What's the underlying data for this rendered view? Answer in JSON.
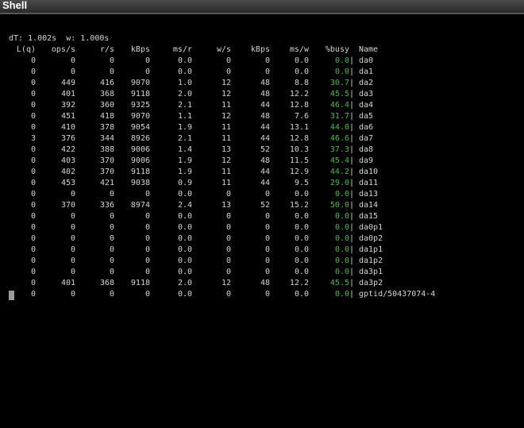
{
  "window": {
    "title": "Shell"
  },
  "terminal": {
    "status_line": "dT: 1.002s  w: 1.000s",
    "columns": [
      "L(q)",
      "ops/s",
      "r/s",
      "kBps",
      "ms/r",
      "w/s",
      "kBps",
      "ms/w",
      "%busy",
      "Name"
    ],
    "rows": [
      [
        "0",
        "0",
        "0",
        "0",
        "0.0",
        "0",
        "0",
        "0.0",
        "0.0",
        "da0"
      ],
      [
        "0",
        "0",
        "0",
        "0",
        "0.0",
        "0",
        "0",
        "0.0",
        "0.0",
        "da1"
      ],
      [
        "0",
        "449",
        "416",
        "9070",
        "1.0",
        "12",
        "48",
        "8.8",
        "30.7",
        "da2"
      ],
      [
        "0",
        "401",
        "368",
        "9118",
        "2.0",
        "12",
        "48",
        "12.2",
        "45.5",
        "da3"
      ],
      [
        "0",
        "392",
        "360",
        "9325",
        "2.1",
        "11",
        "44",
        "12.8",
        "46.4",
        "da4"
      ],
      [
        "0",
        "451",
        "418",
        "9070",
        "1.1",
        "12",
        "48",
        "7.6",
        "31.7",
        "da5"
      ],
      [
        "0",
        "410",
        "378",
        "9054",
        "1.9",
        "11",
        "44",
        "13.1",
        "44.0",
        "da6"
      ],
      [
        "3",
        "376",
        "344",
        "8926",
        "2.1",
        "11",
        "44",
        "12.8",
        "46.6",
        "da7"
      ],
      [
        "0",
        "422",
        "388",
        "9006",
        "1.4",
        "13",
        "52",
        "10.3",
        "37.3",
        "da8"
      ],
      [
        "0",
        "403",
        "370",
        "9006",
        "1.9",
        "12",
        "48",
        "11.5",
        "45.4",
        "da9"
      ],
      [
        "0",
        "402",
        "370",
        "9118",
        "1.9",
        "11",
        "44",
        "12.9",
        "44.2",
        "da10"
      ],
      [
        "0",
        "453",
        "421",
        "9038",
        "0.9",
        "11",
        "44",
        "9.5",
        "29.0",
        "da11"
      ],
      [
        "0",
        "0",
        "0",
        "0",
        "0.0",
        "0",
        "0",
        "0.0",
        "0.0",
        "da13"
      ],
      [
        "0",
        "370",
        "336",
        "8974",
        "2.4",
        "13",
        "52",
        "15.2",
        "50.0",
        "da14"
      ],
      [
        "0",
        "0",
        "0",
        "0",
        "0.0",
        "0",
        "0",
        "0.0",
        "0.0",
        "da15"
      ],
      [
        "0",
        "0",
        "0",
        "0",
        "0.0",
        "0",
        "0",
        "0.0",
        "0.0",
        "da0p1"
      ],
      [
        "0",
        "0",
        "0",
        "0",
        "0.0",
        "0",
        "0",
        "0.0",
        "0.0",
        "da0p2"
      ],
      [
        "0",
        "0",
        "0",
        "0",
        "0.0",
        "0",
        "0",
        "0.0",
        "0.0",
        "da1p1"
      ],
      [
        "0",
        "0",
        "0",
        "0",
        "0.0",
        "0",
        "0",
        "0.0",
        "0.0",
        "da1p2"
      ],
      [
        "0",
        "0",
        "0",
        "0",
        "0.0",
        "0",
        "0",
        "0.0",
        "0.0",
        "da3p1"
      ],
      [
        "0",
        "401",
        "368",
        "9118",
        "2.0",
        "12",
        "48",
        "12.2",
        "45.5",
        "da3p2"
      ],
      [
        "0",
        "0",
        "0",
        "0",
        "0.0",
        "0",
        "0",
        "0.0",
        "0.0",
        "gptid/50437074-4"
      ]
    ],
    "separator": "|"
  },
  "colors": {
    "background": "#000000",
    "text": "#d6d6d6",
    "busy_value": "#3fc23f",
    "titlebar": "#3a3a3a"
  }
}
